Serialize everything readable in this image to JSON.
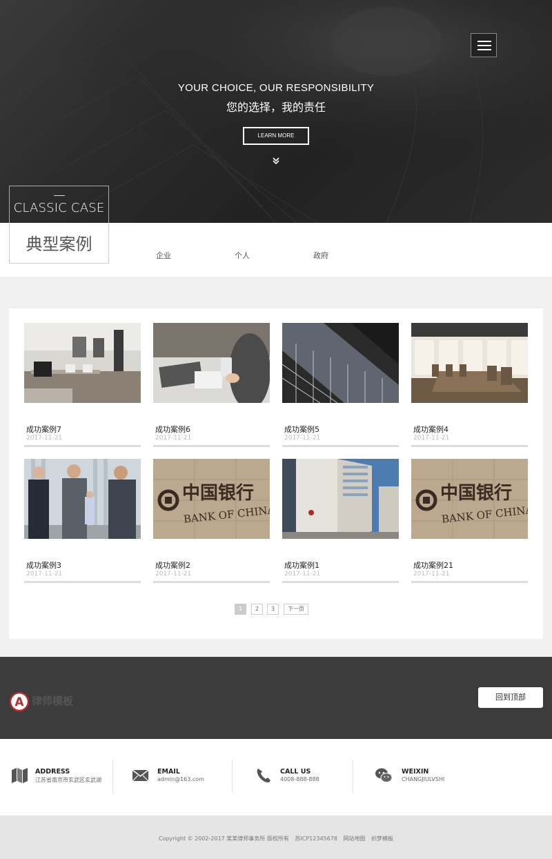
{
  "hero": {
    "title": "YOUR CHOICE, OUR RESPONSIBILITY",
    "subtitle": "您的选择，我的责任",
    "button": "LEARN MORE"
  },
  "section": {
    "title_en": "CLASSIC CASE",
    "title_cn": "典型案例",
    "tabs": [
      "企业",
      "个人",
      "政府"
    ]
  },
  "cases": [
    {
      "name": "成功案例7",
      "date": "2017-11-21",
      "image": "office-computers"
    },
    {
      "name": "成功案例6",
      "date": "2017-11-21",
      "image": "phone-on-desk"
    },
    {
      "name": "成功案例5",
      "date": "2017-11-21",
      "image": "glass-building"
    },
    {
      "name": "成功案例4",
      "date": "2017-11-21",
      "image": "conference-room"
    },
    {
      "name": "成功案例3",
      "date": "2017-11-21",
      "image": "business-handshake"
    },
    {
      "name": "成功案例2",
      "date": "2017-11-21",
      "image": "bank-of-china-sign"
    },
    {
      "name": "成功案例1",
      "date": "2017-11-21",
      "image": "bank-building"
    },
    {
      "name": "成功案例21",
      "date": "2017-11-21",
      "image": "bank-of-china-sign"
    }
  ],
  "bank_sign": {
    "cn": "中国银行",
    "en": "BANK OF CHINA"
  },
  "pagination": {
    "pages": [
      "1",
      "2",
      "3"
    ],
    "current": "1",
    "next": "下一页"
  },
  "brand": {
    "logo_letter": "A",
    "name": "律师模板"
  },
  "back_to_top": "回到顶部",
  "contact": [
    {
      "label": "ADDRESS",
      "value": "江苏省南京市玄武区玄武湖",
      "icon": "map-icon"
    },
    {
      "label": "EMAIL",
      "value": "admin@163.com",
      "icon": "envelope-icon"
    },
    {
      "label": "CALL US",
      "value": "4008-888-888",
      "icon": "phone-icon"
    },
    {
      "label": "WEIXIN",
      "value": "CHANGJIULVSHI",
      "icon": "wechat-icon"
    }
  ],
  "footer": {
    "copyright": "Copyright © 2002-2017 某某律师事务所 版权所有",
    "icp": "苏ICP12345678",
    "sitemap": "网站地图",
    "template": "织梦模板"
  }
}
